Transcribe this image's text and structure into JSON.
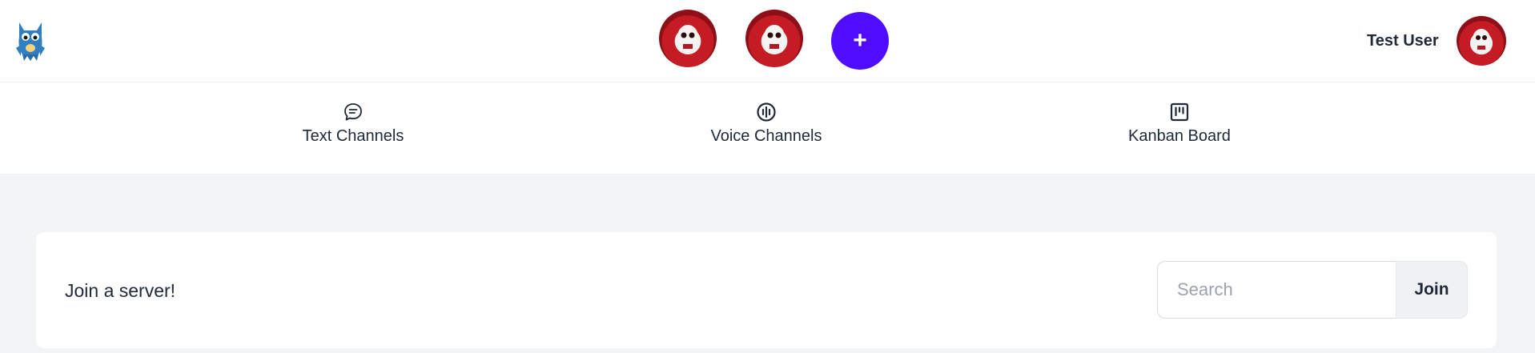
{
  "header": {
    "logo_icon": "owl-mascot-icon",
    "server_avatars": [
      {
        "name": "server-avatar-1",
        "icon": "skull-avatar-icon"
      },
      {
        "name": "server-avatar-2",
        "icon": "skull-avatar-icon"
      }
    ],
    "add_server_label": "+",
    "username": "Test User",
    "user_avatar_icon": "skull-avatar-icon",
    "accent_color": "#4f0cff"
  },
  "tabs": [
    {
      "label": "Text Channels",
      "icon": "chat-bubble-icon"
    },
    {
      "label": "Voice Channels",
      "icon": "voice-wave-icon"
    },
    {
      "label": "Kanban Board",
      "icon": "kanban-board-icon"
    }
  ],
  "join_card": {
    "title": "Join a server!",
    "search_placeholder": "Search",
    "search_value": "",
    "join_label": "Join"
  }
}
